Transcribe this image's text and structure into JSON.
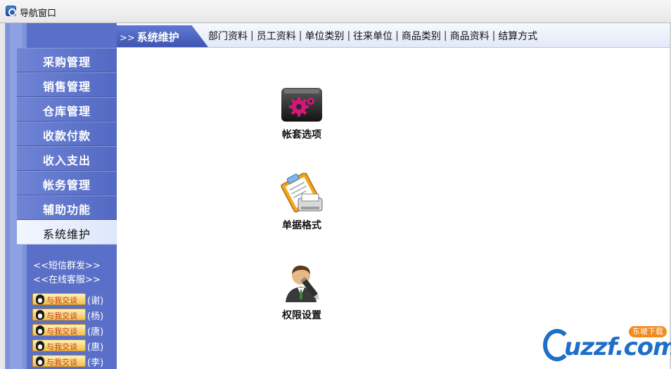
{
  "window": {
    "title": "导航窗口"
  },
  "sidebar": {
    "items": [
      {
        "label": "采购管理"
      },
      {
        "label": "销售管理"
      },
      {
        "label": "仓库管理"
      },
      {
        "label": "收款付款"
      },
      {
        "label": "收入支出"
      },
      {
        "label": "帐务管理"
      },
      {
        "label": "辅助功能"
      },
      {
        "label": "系统维护",
        "active": true
      }
    ],
    "links": [
      {
        "label": "<<短信群发>>"
      },
      {
        "label": "<<在线客服>>"
      }
    ],
    "qq": {
      "badge_label": "与我交谈",
      "contacts": [
        {
          "name": "(谢)"
        },
        {
          "name": "(杨)"
        },
        {
          "name": "(唐)"
        },
        {
          "name": "(惠)"
        },
        {
          "name": "(李)"
        }
      ]
    }
  },
  "topbar": {
    "section_arrows": ">>",
    "section_title": "系统维护",
    "separator": "|",
    "links": [
      {
        "label": "部门资料"
      },
      {
        "label": "员工资料"
      },
      {
        "label": "单位类别"
      },
      {
        "label": "往来单位"
      },
      {
        "label": "商品类别"
      },
      {
        "label": "商品资料"
      },
      {
        "label": "结算方式"
      }
    ]
  },
  "content": {
    "tools": [
      {
        "label": "帐套选项",
        "icon": "gear-settings-icon"
      },
      {
        "label": "单据格式",
        "icon": "clipboard-printer-icon"
      },
      {
        "label": "权限设置",
        "icon": "user-pen-icon"
      }
    ]
  },
  "watermark": {
    "text": "uzzf.com",
    "badge": "东坡下载"
  },
  "colors": {
    "sidebar_bg": "#5a70c8",
    "sidebar_active_bg": "#e6eefc",
    "topbar_tab": "#4a63c0",
    "watermark_blue": "#1e6fc7",
    "watermark_orange": "#f28a1e"
  }
}
